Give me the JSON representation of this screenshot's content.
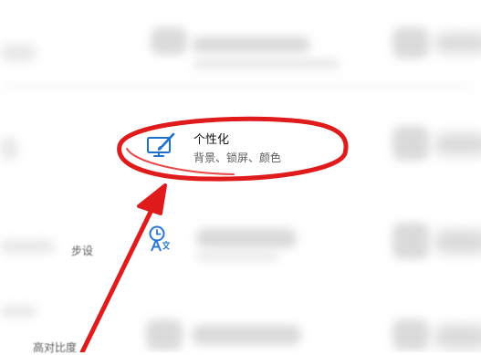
{
  "personalization": {
    "title": "个性化",
    "subtitle": "背景、锁屏、颜色"
  },
  "sidebar_fragments": {
    "item_one": "步设",
    "item_two": "高对比度"
  },
  "icons": {
    "personalization": "paint-screen-icon",
    "time_language": "clock-language-icon"
  },
  "colors": {
    "annotation_red": "#e01b1b",
    "icon_blue": "#1e6fcf"
  }
}
